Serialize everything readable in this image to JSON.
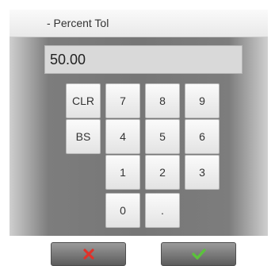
{
  "header": {
    "title": "- Percent Tol"
  },
  "input": {
    "value": "50.00"
  },
  "keypad": {
    "clr": "CLR",
    "bs": "BS",
    "k7": "7",
    "k8": "8",
    "k9": "9",
    "k4": "4",
    "k5": "5",
    "k6": "6",
    "k1": "1",
    "k2": "2",
    "k3": "3",
    "k0": "0",
    "dot": "."
  },
  "footer": {
    "cancel_icon": "x-icon",
    "confirm_icon": "checkmark-icon",
    "cancel_color": "#e0322a",
    "confirm_color": "#5bc23c"
  }
}
